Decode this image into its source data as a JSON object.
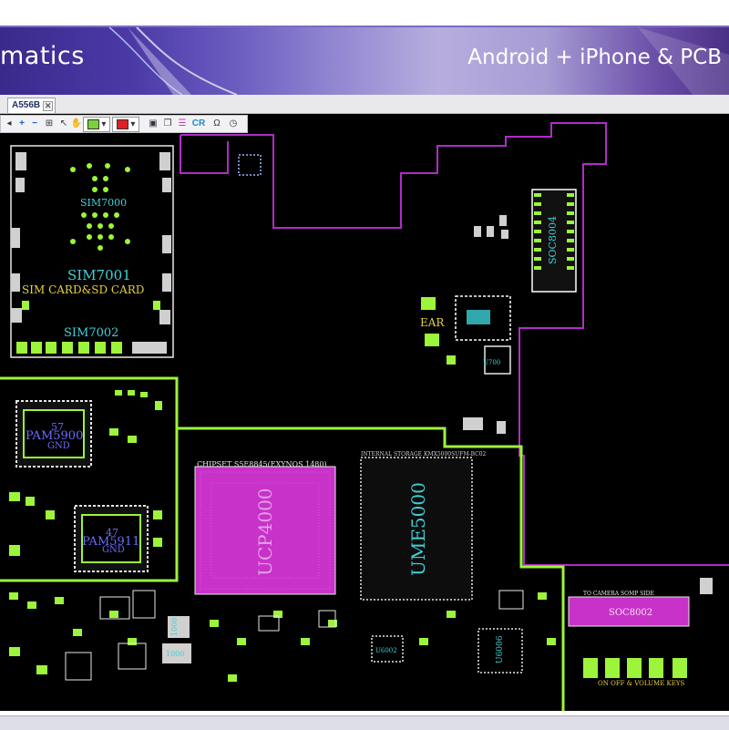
{
  "banner": {
    "title": "matics",
    "subtitle": "Android + iPhone & PCB"
  },
  "tabs": [
    {
      "label": "A556B",
      "close_glyph": "✕"
    }
  ],
  "toolbar": {
    "icons": [
      "zoom-in-icon",
      "zoom-out-icon",
      "fit-icon",
      "select-icon",
      "color-green-dropdown",
      "color-red-dropdown",
      "layers-icon",
      "copy-icon",
      "list-icon",
      "cr-icon",
      "omega-icon",
      "clock-icon"
    ],
    "zoom_in": "+",
    "zoom_out": "−",
    "cr_label": "CR",
    "omega": "Ω",
    "color1": "#7ad23a",
    "color2": "#e02020"
  },
  "board": {
    "background": "#000000",
    "outline_color": "#b02cc8",
    "region_color": "#9cf53a",
    "labels": {
      "sim7000": "SIM7000",
      "sim7001": "SIM7001",
      "sim_card": "SIM CARD&SD CARD",
      "sim7002": "SIM7002",
      "soc8004": "SOC8004",
      "ear": "EAR",
      "u700": "U700",
      "pam_top": "PAM5900",
      "pam_top_num": "57",
      "pam_top_gnd": "GND",
      "pam_bot": "PAM5911",
      "pam_bot_num": "47",
      "pam_bot_gnd": "GND",
      "chipset": "CHIPSET S5E8845(EXYNOS 1480)",
      "ucp": "UCP4000",
      "storage": "INTERNAL STORAGE KMX5000SUFM-BC02",
      "ume": "UME5000",
      "soc8002": "SOC8002",
      "camera": "TO CAMERA SOMP SIDE",
      "keys": "ON OFF & VOLUME KEYS",
      "u6002": "U6002",
      "u6006": "U6006",
      "c1": "1000",
      "c2": "1000"
    }
  }
}
